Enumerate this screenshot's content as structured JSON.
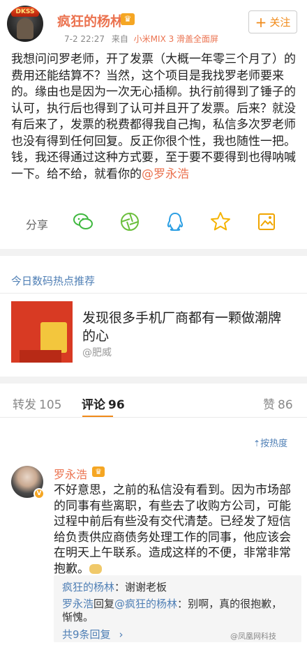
{
  "post": {
    "author": "疯狂的杨林",
    "vip_icon": "crown-icon",
    "date": "7-2 22:27",
    "source_prefix": "来自",
    "device": "小米MIX 3 滑盖全面屏",
    "follow_label": "关注",
    "text_before": "我想问问罗老师，开了发票（大概一年零三个月了）的费用还能结算不？当然，这个项目是我找罗老师要来的。缘由也是因为一次无心插柳。执行前得到了锤子的认可，执行后也得到了认可并且开了发票。后来？就没有后来了，发票的税费都得我自己掏，私信多次罗老师也没有得到任何回复。反正你很个性，我也随性一把。钱，我还得通过这种方式要，至于要不要得到也得呐喊一下。给不给，就看你的",
    "mention": "@罗永浩",
    "avatar_badge": "DKSS"
  },
  "actions": {
    "share_label": "分享",
    "icons": [
      "wechat-icon",
      "moments-icon",
      "qq-icon",
      "qzone-icon",
      "image-share-icon"
    ]
  },
  "hot": {
    "section_title": "今日数码热点推荐",
    "headline": "发现很多手机厂商都有一颗做潮牌的心",
    "author": "@肥威"
  },
  "tabs": {
    "repost_label": "转发",
    "repost_count": "105",
    "comment_label": "评论",
    "comment_count": "96",
    "like_label": "赞",
    "like_count": "86"
  },
  "sort": {
    "label": "按热度"
  },
  "comment": {
    "author": "罗永浩",
    "text": "不好意思，之前的私信没有看到。因为市场部的同事有些离职，有些去了收购方公司，可能过程中前后有些没有交代清楚。已经发了短信给负责供应商债务处理工作的同事，他应该会在明天上午联系。造成这样的不便，非常非常抱歉。",
    "replies": [
      {
        "who": "疯狂的杨林",
        "sep": "：",
        "text": "谢谢老板"
      },
      {
        "who": "罗永浩",
        "mid": "回复",
        "target": "@疯狂的杨林",
        "sep": "：",
        "text": "别啊，真的很抱歉，惭愧。"
      }
    ],
    "more_label": "共9条回复"
  },
  "watermark": "@凤凰网科技"
}
